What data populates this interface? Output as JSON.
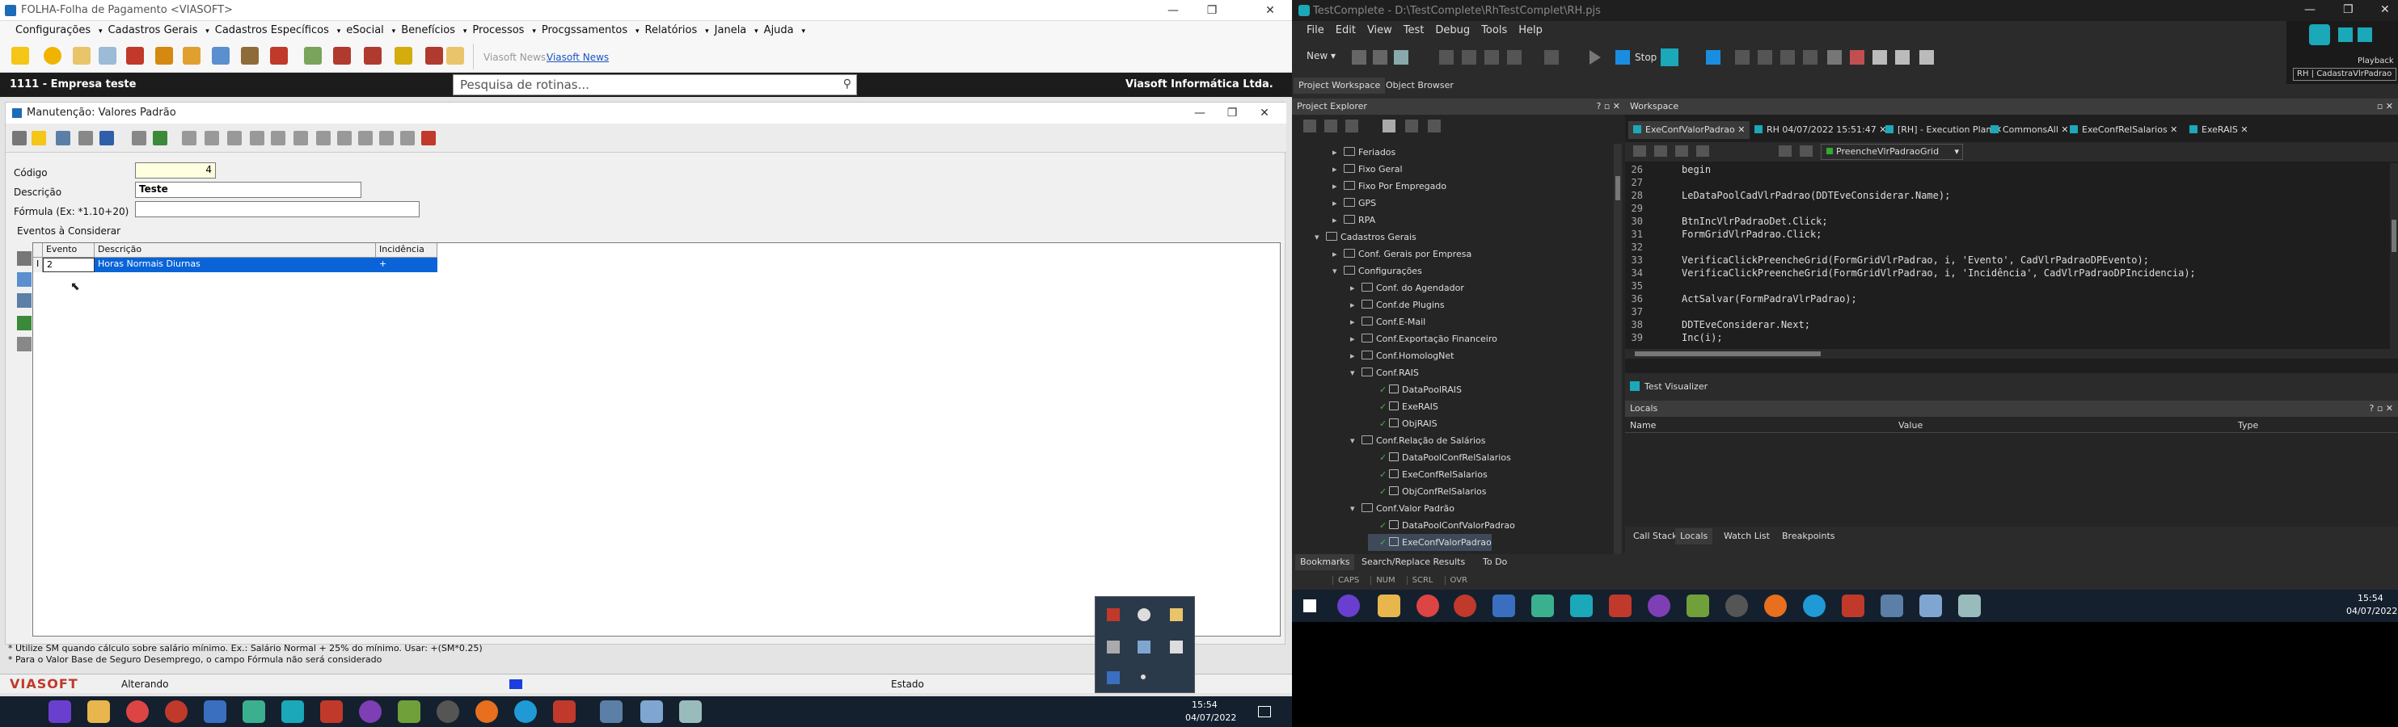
{
  "left_app": {
    "title": "FOLHA-Folha de Pagamento <VIASOFT>",
    "menu": [
      "Configurações",
      "Cadastros Gerais",
      "Cadastros Específicos",
      "eSocial",
      "Benefícios",
      "Processos",
      "Procgssamentos",
      "Relatórios",
      "Janela",
      "Ajuda"
    ],
    "news_label": "Viasoft News:",
    "news_link": "Viasoft News",
    "company_left": "1111 - Empresa teste",
    "company_right": "Viasoft Informática Ltda.",
    "search_placeholder": "Pesquisa de rotinas...",
    "form": {
      "title": "Manutenção: Valores Padrão",
      "codigo_label": "Código",
      "codigo_value": "4",
      "descricao_label": "Descrição",
      "descricao_value": "Teste",
      "formula_label": "Fórmula (Ex: *1.10+20)",
      "formula_value": "",
      "eventos_label": "Eventos à Considerar",
      "grid_headers": [
        "Evento",
        "Descrição",
        "Incidência"
      ],
      "grid_rows": [
        {
          "marker": "I",
          "evento": "2",
          "descricao": "Horas Normais Diurnas",
          "incidencia": "+"
        }
      ],
      "note1": "* Utilize SM quando cálculo sobre salário mínimo. Ex.: Salário Normal + 25% do mínimo. Usar: +(SM*0.25)",
      "note2": "* Para o Valor Base de Seguro Desemprego, o campo Fórmula não será considerado"
    },
    "status": {
      "brand": "VIASOFT",
      "mode": "Alterando",
      "estado": "Estado"
    }
  },
  "taskbar": {
    "time": "15:54",
    "date": "04/07/2022"
  },
  "ide": {
    "title": "TestComplete - D:\\TestComplete\\RhTestComplet\\RH.pjs",
    "menu": [
      "File",
      "Edit",
      "View",
      "Test",
      "Debug",
      "Tools",
      "Help"
    ],
    "new_label": "New",
    "stop_label": "Stop",
    "playback_label": "Playback",
    "playback_sub": "RH | CadastraVlrPadrao",
    "tabs_left": [
      "Project Workspace",
      "Object Browser"
    ],
    "explorer_title": "Project Explorer",
    "workspace_title": "Workspace",
    "tree": [
      {
        "indent": 5,
        "label": "Feriados",
        "type": "folder",
        "exp": "▸"
      },
      {
        "indent": 5,
        "label": "Fixo Geral",
        "type": "folder",
        "exp": "▸"
      },
      {
        "indent": 5,
        "label": "Fixo Por Empregado",
        "type": "folder",
        "exp": "▸"
      },
      {
        "indent": 5,
        "label": "GPS",
        "type": "folder",
        "exp": "▸"
      },
      {
        "indent": 5,
        "label": "RPA",
        "type": "folder",
        "exp": "▸"
      },
      {
        "indent": 4,
        "label": "Cadastros Gerais",
        "type": "folder",
        "exp": "▾"
      },
      {
        "indent": 5,
        "label": "Conf. Gerais por Empresa",
        "type": "folder",
        "exp": "▸"
      },
      {
        "indent": 5,
        "label": "Configurações",
        "type": "folder",
        "exp": "▾"
      },
      {
        "indent": 6,
        "label": "Conf. do Agendador",
        "type": "folder",
        "exp": "▸"
      },
      {
        "indent": 6,
        "label": "Conf.de Plugins",
        "type": "folder",
        "exp": "▸"
      },
      {
        "indent": 6,
        "label": "Conf.E-Mail",
        "type": "folder",
        "exp": "▸"
      },
      {
        "indent": 6,
        "label": "Conf.Exportação Financeiro",
        "type": "folder",
        "exp": "▸"
      },
      {
        "indent": 6,
        "label": "Conf.HomologNet",
        "type": "folder",
        "exp": "▸"
      },
      {
        "indent": 6,
        "label": "Conf.RAIS",
        "type": "folder",
        "exp": "▾"
      },
      {
        "indent": 7,
        "label": "DataPoolRAIS",
        "type": "item",
        "exp": ""
      },
      {
        "indent": 7,
        "label": "ExeRAIS",
        "type": "item",
        "exp": ""
      },
      {
        "indent": 7,
        "label": "ObjRAIS",
        "type": "item",
        "exp": ""
      },
      {
        "indent": 6,
        "label": "Conf.Relação de Salários",
        "type": "folder",
        "exp": "▾"
      },
      {
        "indent": 7,
        "label": "DataPoolConfRelSalarios",
        "type": "item",
        "exp": ""
      },
      {
        "indent": 7,
        "label": "ExeConfRelSalarios",
        "type": "item",
        "exp": ""
      },
      {
        "indent": 7,
        "label": "ObjConfRelSalarios",
        "type": "item",
        "exp": ""
      },
      {
        "indent": 6,
        "label": "Conf.Valor Padrão",
        "type": "folder",
        "exp": "▾"
      },
      {
        "indent": 7,
        "label": "DataPoolConfValorPadrao",
        "type": "item",
        "exp": ""
      },
      {
        "indent": 7,
        "label": "ExeConfValorPadrao",
        "type": "item",
        "exp": ""
      }
    ],
    "editor_tabs": [
      "ExeConfValorPadrao",
      "RH 04/07/2022 15:51:47",
      "[RH] - Execution Plan",
      "CommonsAll",
      "ExeConfRelSalarios",
      "ExeRAIS"
    ],
    "routine_select": "PreencheVlrPadraoGrid",
    "code_lines": [
      {
        "n": "26",
        "t": "begin"
      },
      {
        "n": "27",
        "t": ""
      },
      {
        "n": "28",
        "t": "LeDataPoolCadVlrPadrao(DDTEveConsiderar.Name);"
      },
      {
        "n": "29",
        "t": ""
      },
      {
        "n": "30",
        "t": "BtnIncVlrPadraoDet.Click;"
      },
      {
        "n": "31",
        "t": "FormGridVlrPadrao.Click;"
      },
      {
        "n": "32",
        "t": ""
      },
      {
        "n": "33",
        "t": "VerificaClickPreencheGrid(FormGridVlrPadrao, i, 'Evento', CadVlrPadraoDPEvento);"
      },
      {
        "n": "34",
        "t": "VerificaClickPreencheGrid(FormGridVlrPadrao, i, 'Incidência', CadVlrPadraoDPIncidencia);"
      },
      {
        "n": "35",
        "t": ""
      },
      {
        "n": "36",
        "t": "ActSalvar(FormPadraVlrPadrao);"
      },
      {
        "n": "37",
        "t": ""
      },
      {
        "n": "38",
        "t": "DDTEveConsiderar.Next;"
      },
      {
        "n": "39",
        "t": "Inc(i);"
      }
    ],
    "test_visualizer": "Test Visualizer",
    "locals_title": "Locals",
    "locals_cols": [
      "Name",
      "Value",
      "Type"
    ],
    "bottom_tabs_right": [
      "Call Stack",
      "Locals",
      "Watch List",
      "Breakpoints"
    ],
    "bottom_tabs_left": [
      "Bookmarks",
      "Search/Replace Results",
      "To Do"
    ],
    "status_keys": [
      "CAPS",
      "NUM",
      "SCRL",
      "OVR"
    ],
    "time": "15:54",
    "date": "04/07/2022"
  }
}
